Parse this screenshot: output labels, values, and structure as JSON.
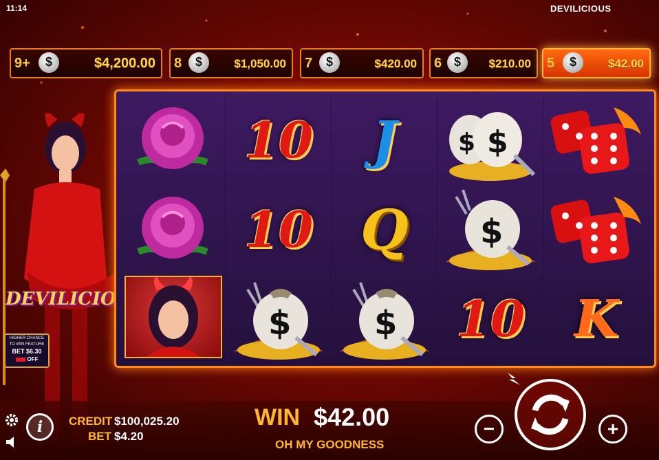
{
  "status": {
    "time": "11:14",
    "game_title": "DEVILICIOUS"
  },
  "payouts": [
    {
      "count": "9+",
      "amount": "$4,200.00",
      "highlighted": false
    },
    {
      "count": "8",
      "amount": "$1,050.00",
      "highlighted": false
    },
    {
      "count": "7",
      "amount": "$420.00",
      "highlighted": false
    },
    {
      "count": "6",
      "amount": "$210.00",
      "highlighted": false
    },
    {
      "count": "5",
      "amount": "$42.00",
      "highlighted": true
    }
  ],
  "bag_icon_glyph": "$",
  "reels": [
    [
      "rose",
      "rose",
      "devil-girl"
    ],
    [
      "10",
      "10",
      "money-bag"
    ],
    [
      "J",
      "Q",
      "money-bag"
    ],
    [
      "money-bag",
      "money-bag",
      "10"
    ],
    [
      "dice",
      "dice",
      "K"
    ]
  ],
  "logo": "DEVILICIOUS",
  "feature": {
    "line1": "HIGHER CHANCE",
    "line2": "TO WIN FEATURE",
    "bet": "BET $6.30",
    "toggle": "OFF"
  },
  "credit": {
    "label": "CREDIT",
    "value": "$100,025.20"
  },
  "bet": {
    "label": "BET",
    "value": "$4.20"
  },
  "win": {
    "label": "WIN",
    "value": "$42.00",
    "message": "OH MY GOODNESS"
  },
  "colors": {
    "accent": "#ffb82e",
    "frame": "#ff8a1e",
    "grid_bg": "#2e1450"
  }
}
